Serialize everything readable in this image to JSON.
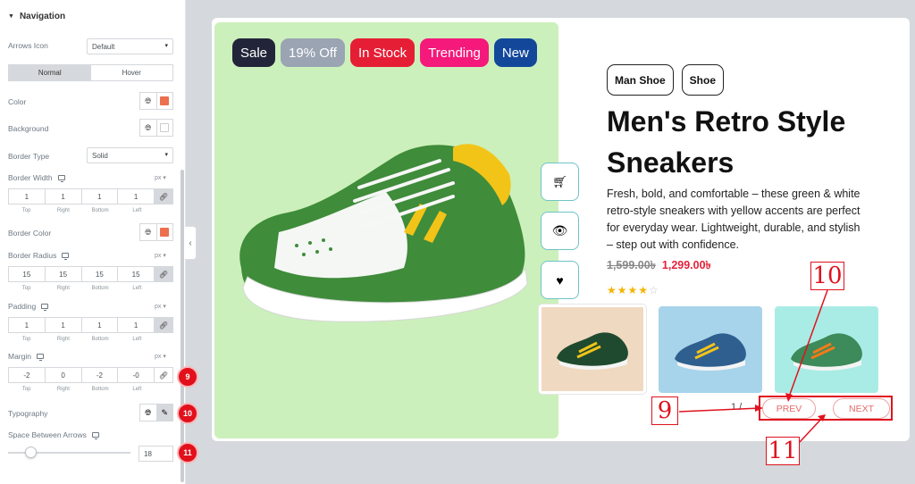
{
  "panel": {
    "section_title": "Navigation",
    "arrows_icon": {
      "label": "Arrows Icon",
      "value": "Default"
    },
    "state_tabs": [
      "Normal",
      "Hover"
    ],
    "color": {
      "label": "Color",
      "swatch": "#ec6f4e"
    },
    "background": {
      "label": "Background",
      "swatch": "#ffffff"
    },
    "border_type": {
      "label": "Border Type",
      "value": "Solid"
    },
    "border_width": {
      "label": "Border Width",
      "unit": "px",
      "values": [
        "1",
        "1",
        "1",
        "1"
      ]
    },
    "border_color": {
      "label": "Border Color",
      "swatch": "#ec6f4e"
    },
    "border_radius": {
      "label": "Border Radius",
      "unit": "px",
      "values": [
        "15",
        "15",
        "15",
        "15"
      ]
    },
    "padding": {
      "label": "Padding",
      "unit": "px",
      "values": [
        "1",
        "1",
        "1",
        "1"
      ]
    },
    "margin": {
      "label": "Margin",
      "unit": "px",
      "values": [
        "-2",
        "0",
        "-2",
        "-0"
      ]
    },
    "dim_labels": [
      "Top",
      "Right",
      "Bottom",
      "Left"
    ],
    "typography": {
      "label": "Typography"
    },
    "space_between": {
      "label": "Space Between Arrows",
      "value": "18"
    },
    "markers": {
      "m9": "9",
      "m10": "10",
      "m11": "11"
    }
  },
  "product": {
    "badges": [
      {
        "label": "Sale",
        "color": "#22253a"
      },
      {
        "label": "19% Off",
        "color": "#9aa4b3"
      },
      {
        "label": "In Stock",
        "color": "#e61e35"
      },
      {
        "label": "Trending",
        "color": "#f4197b"
      },
      {
        "label": "New",
        "color": "#12479a"
      }
    ],
    "tags": [
      "Man Shoe",
      "Shoe"
    ],
    "title": "Men's Retro Style Sneakers",
    "description": "Fresh, bold, and comfortable – these green & white retro-style sneakers with yellow accents are perfect for everyday wear. Lightweight, durable, and stylish – step out with confidence.",
    "price_old": "1,599.00৳",
    "price_new": "1,299.00৳",
    "rating": 4,
    "rating_max": 5,
    "pager": "1 /",
    "prev_label": "PREV",
    "next_label": "NEXT",
    "thumb_backgrounds": [
      "#efd9c0",
      "#a7d4ea",
      "#a9ece5"
    ]
  },
  "annotations": {
    "a9": "9",
    "a10": "10",
    "a11": "11"
  }
}
